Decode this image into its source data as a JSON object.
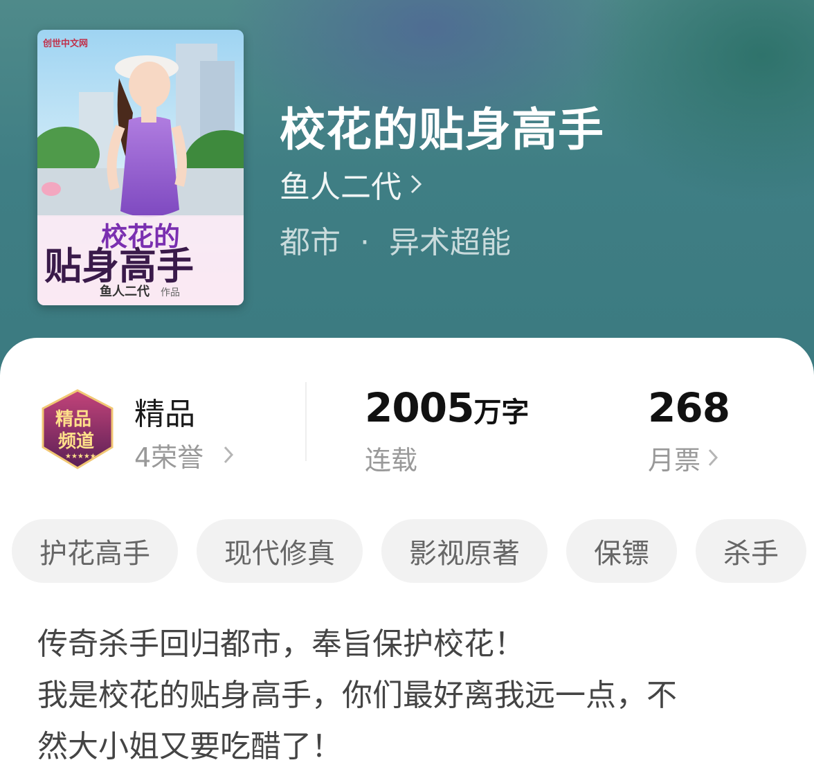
{
  "book": {
    "title": "校花的贴身高手",
    "author": "鱼人二代",
    "category": "都市",
    "category_separator": "·",
    "subcategory": "异术超能"
  },
  "cover": {
    "publisher_logo": "创世中文网",
    "title_line1": "校花的",
    "title_line2": "贴身高手",
    "author_credit": "鱼人二代",
    "credit_suffix": "作品"
  },
  "stats": {
    "grade": {
      "badge_icon": "premium-channel-badge",
      "badge_text_line1": "精品",
      "badge_text_line2": "频道",
      "title": "精品",
      "honors": "4荣誉"
    },
    "words": {
      "value": "2005",
      "unit": "万字",
      "status": "连载"
    },
    "monthly_votes": {
      "value": "268",
      "label": "月票"
    }
  },
  "tags": [
    "护花高手",
    "现代修真",
    "影视原著",
    "保镖",
    "杀手"
  ],
  "description": [
    "传奇杀手回归都市，奉旨保护校花！",
    "我是校花的贴身高手，你们最好离我远一点，不",
    "然大小姐又要吃醋了！"
  ],
  "colors": {
    "hero_bg": "#3f7e84",
    "tag_bg": "#f2f2f2",
    "muted_text": "#999999",
    "badge_purple": "#6b2a5e"
  }
}
